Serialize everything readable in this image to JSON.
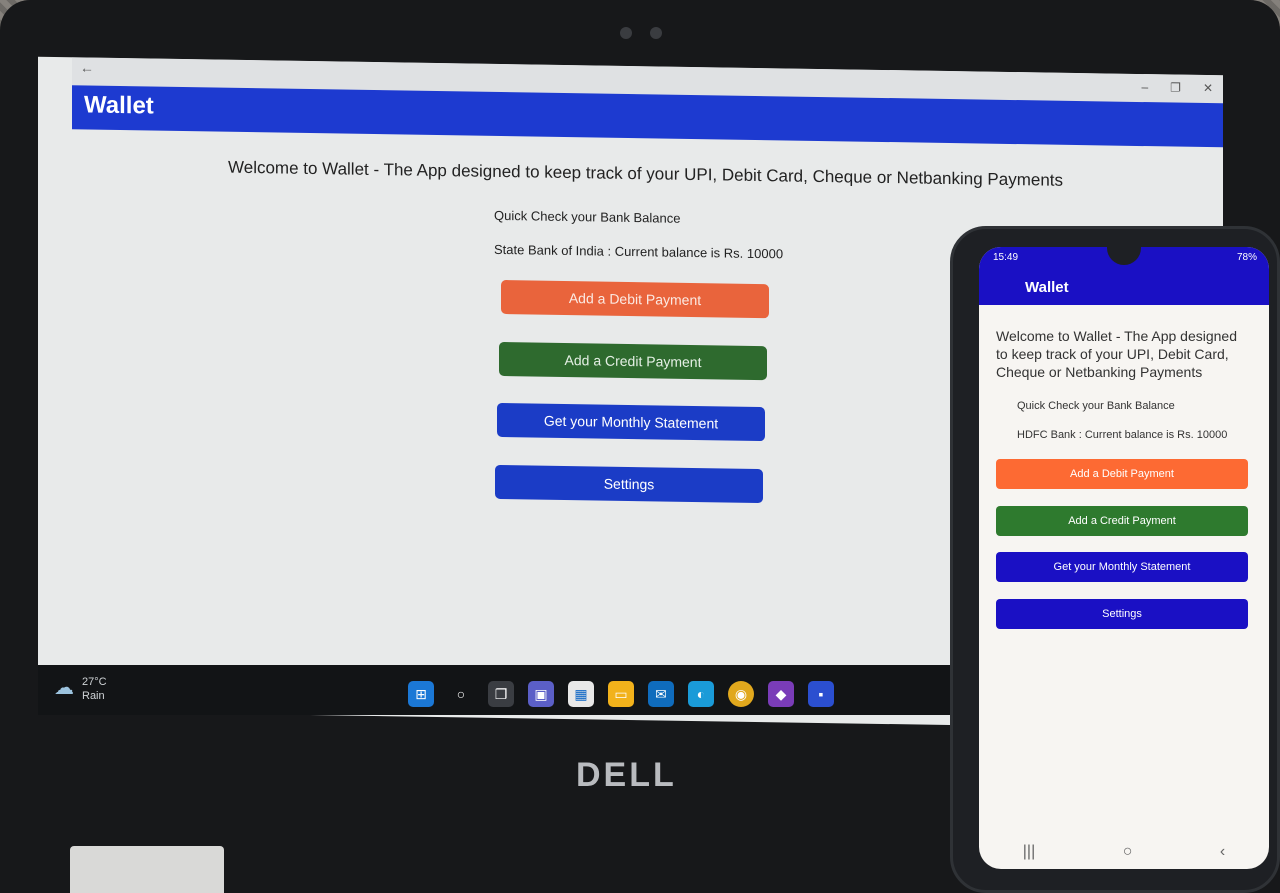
{
  "laptop": {
    "brand": "DELL",
    "app": {
      "back_glyph": "←",
      "window_controls": [
        "–",
        "❐",
        "✕"
      ],
      "title": "Wallet",
      "welcome": "Welcome to Wallet - The App designed to keep track of your UPI, Debit Card, Cheque or Netbanking Payments",
      "quick_check": "Quick Check your Bank Balance",
      "balance": "State Bank of India : Current balance is Rs. 10000",
      "buttons": {
        "debit": "Add a Debit Payment",
        "credit": "Add a Credit Payment",
        "statement": "Get your Monthly Statement",
        "settings": "Settings"
      },
      "colors": {
        "appbar": "#1d3ad0",
        "debit": "#e9643c",
        "credit": "#2e6a2e",
        "primary": "#1b3cc6"
      }
    },
    "taskbar": {
      "weather_temp": "27°C",
      "weather_desc": "Rain",
      "icons": [
        "windows-icon",
        "search-icon",
        "task-view-icon",
        "teams-icon",
        "store-icon",
        "file-explorer-icon",
        "mail-icon",
        "edge-icon",
        "chrome-icon",
        "visual-studio-icon",
        "dotnet-app-icon"
      ]
    }
  },
  "phone": {
    "status_time": "15:49",
    "battery": "78%",
    "app": {
      "title": "Wallet",
      "welcome": "Welcome to Wallet - The App designed to keep track of your UPI, Debit Card, Cheque or Netbanking Payments",
      "quick_check": "Quick Check your Bank Balance",
      "balance": "HDFC Bank : Current balance is Rs. 10000",
      "buttons": {
        "debit": "Add a Debit Payment",
        "credit": "Add a Credit Payment",
        "statement": "Get your Monthly Statement",
        "settings": "Settings"
      },
      "colors": {
        "appbar": "#1a10c4",
        "debit": "#fd6a33",
        "credit": "#2e7a2e",
        "primary": "#1a10c4"
      }
    },
    "nav": {
      "recents": "|||",
      "home": "○",
      "back": "‹"
    }
  }
}
